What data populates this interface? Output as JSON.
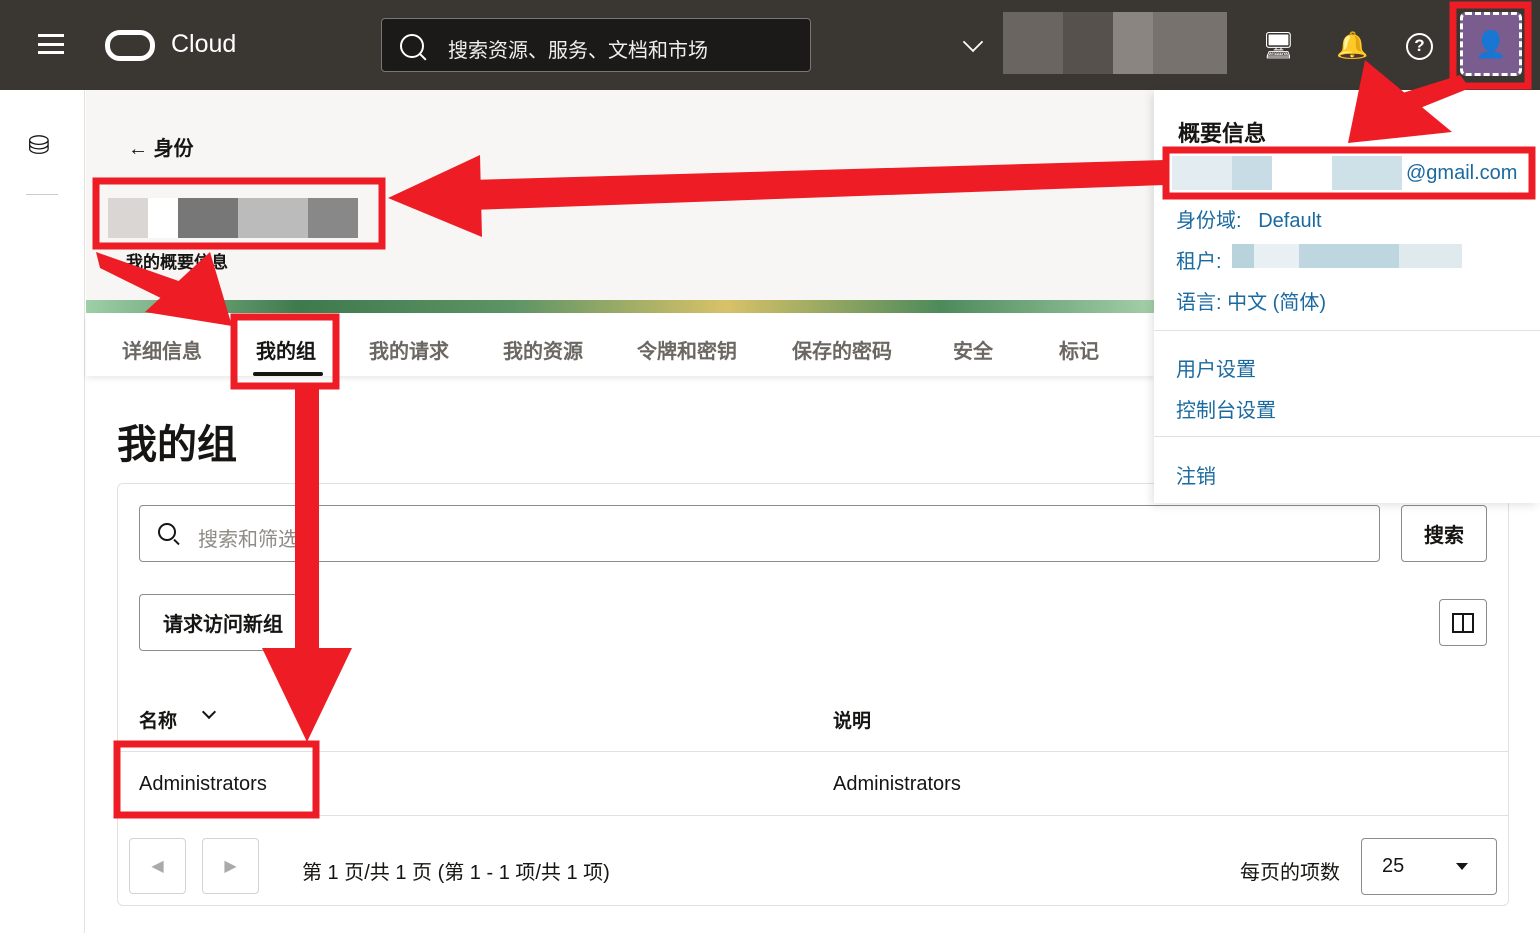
{
  "header": {
    "brand": "Cloud",
    "search_placeholder": "搜索资源、服务、文档和市场",
    "icons": [
      "menu-icon",
      "oracle-logo",
      "code-editor-icon",
      "bell-icon",
      "help-icon",
      "user-avatar-icon"
    ]
  },
  "page": {
    "back_label": "身份",
    "subtitle": "我的概要信息",
    "tabs": [
      "详细信息",
      "我的组",
      "我的请求",
      "我的资源",
      "令牌和密钥",
      "保存的密码",
      "安全",
      "标记"
    ],
    "active_tab": 1,
    "title": "我的组"
  },
  "groups": {
    "filter_placeholder": "搜索和筛选",
    "search_button": "搜索",
    "request_button": "请求访问新组",
    "columns": [
      "名称",
      "说明"
    ],
    "rows": [
      {
        "name": "Administrators",
        "description": "Administrators"
      }
    ],
    "pagination": "第 1 页/共 1 页 (第 1 - 1 项/共 1 项)",
    "per_page_label": "每页的项数",
    "per_page": "25"
  },
  "profile_menu": {
    "title": "概要信息",
    "email_suffix": "@gmail.com",
    "domain_label": "身份域:",
    "domain_value": "Default",
    "tenant_label": "租户:",
    "language_label": "语言:",
    "language_value": "中文 (简体)",
    "user_settings": "用户设置",
    "console_settings": "控制台设置",
    "sign_out": "注销"
  },
  "colors": {
    "header": "#3a3632",
    "annotation": "#ee1c25",
    "link": "#1a6aa0"
  }
}
